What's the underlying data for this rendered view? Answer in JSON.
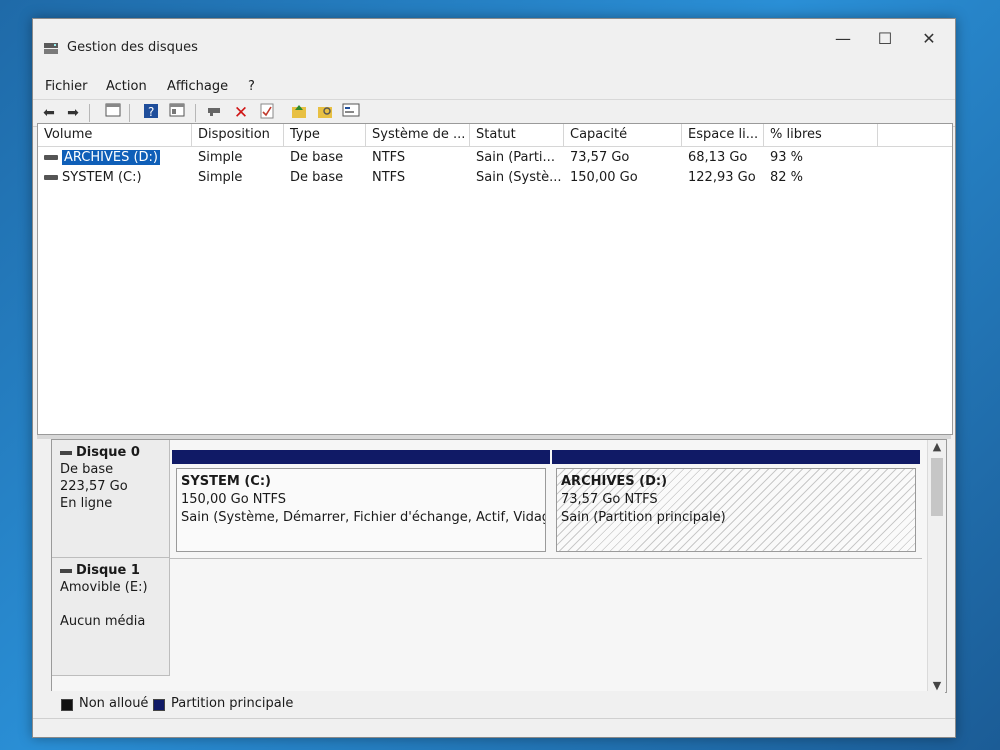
{
  "window": {
    "title": "Gestion des disques",
    "controls": {
      "minimize": "—",
      "maximize": "☐",
      "close": "✕"
    }
  },
  "menu": [
    {
      "label": "Fichier"
    },
    {
      "label": "Action"
    },
    {
      "label": "Affichage"
    },
    {
      "label": "?"
    }
  ],
  "toolbar_icons": [
    "back-icon",
    "forward-icon",
    "console-tree-icon",
    "help-icon",
    "properties-icon",
    "connect-icon",
    "delete-icon",
    "check-icon",
    "folder-up-icon",
    "folder-search-icon",
    "disk-view-icon"
  ],
  "volumes_table": {
    "headers": [
      "Volume",
      "Disposition",
      "Type",
      "Système de ...",
      "Statut",
      "Capacité",
      "Espace li...",
      "% libres"
    ],
    "rows": [
      {
        "volume": "ARCHIVES (D:)",
        "disposition": "Simple",
        "type": "De base",
        "fs": "NTFS",
        "statut": "Sain (Parti...",
        "capacite": "73,57 Go",
        "espace": "68,13 Go",
        "libres": "93 %",
        "selected": true
      },
      {
        "volume": "SYSTEM (C:)",
        "disposition": "Simple",
        "type": "De base",
        "fs": "NTFS",
        "statut": "Sain (Systè...",
        "capacite": "150,00 Go",
        "espace": "122,93 Go",
        "libres": "82 %",
        "selected": false
      }
    ]
  },
  "disks": [
    {
      "name": "Disque 0",
      "type": "De base",
      "size": "223,57 Go",
      "state": "En ligne",
      "partitions": [
        {
          "name": "SYSTEM  (C:)",
          "size_fs": "150,00 Go NTFS",
          "status": "Sain (Système, Démarrer, Fichier d'échange, Actif, Vidage s"
        },
        {
          "name": "ARCHIVES  (D:)",
          "size_fs": "73,57 Go NTFS",
          "status": "Sain (Partition principale)"
        }
      ]
    },
    {
      "name": "Disque 1",
      "type": "Amovible (E:)",
      "state": "Aucun média"
    }
  ],
  "legend": [
    {
      "label": "Non alloué",
      "color": "#111111"
    },
    {
      "label": "Partition principale",
      "color": "#101a66"
    }
  ],
  "colors": {
    "selection": "#0f5fb8",
    "primary_partition": "#101a66"
  }
}
